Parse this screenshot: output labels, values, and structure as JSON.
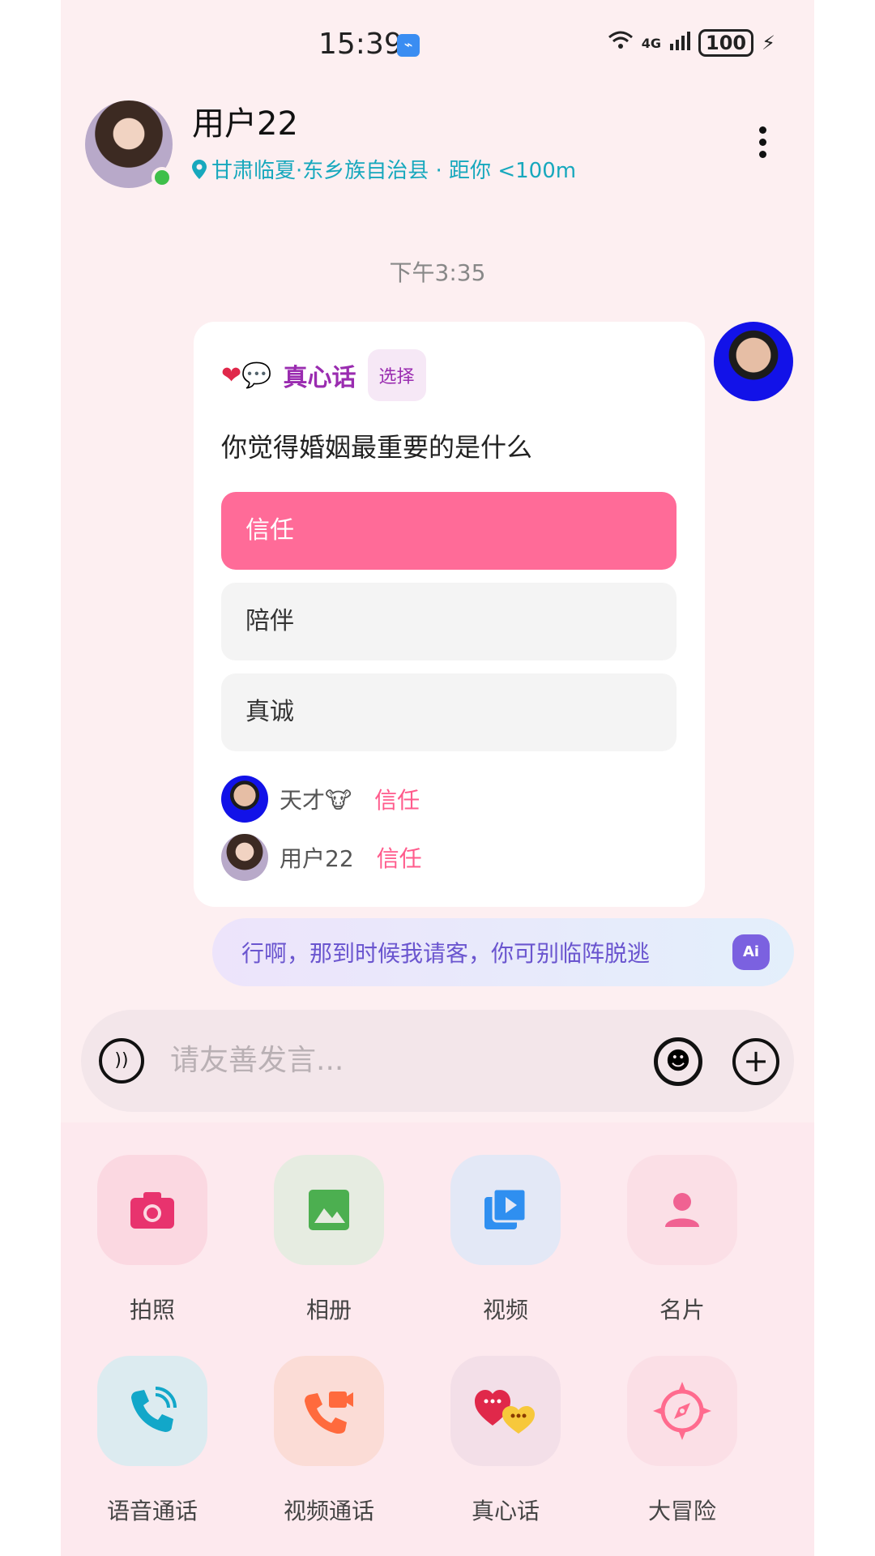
{
  "status": {
    "time": "15:39",
    "network": "4G",
    "battery": "100"
  },
  "header": {
    "username": "用户22",
    "location": "甘肃临夏·东乡族自治县 · 距你 <100m"
  },
  "chat": {
    "timestamp": "下午3:35",
    "card": {
      "title": "真心话",
      "tag": "选择",
      "question": "你觉得婚姻最重要的是什么",
      "options": [
        "信任",
        "陪伴",
        "真诚"
      ],
      "selected_option": "信任",
      "votes": [
        {
          "name": "天才🐮",
          "answer": "信任"
        },
        {
          "name": "用户22",
          "answer": "信任"
        }
      ]
    },
    "ai_suggestion": "行啊，那到时候我请客，你可别临阵脱逃",
    "ai_icon_label": "Ai"
  },
  "input": {
    "placeholder": "请友善发言..."
  },
  "actions": [
    {
      "label": "拍照",
      "icon": "camera-icon",
      "color": "#e8336e"
    },
    {
      "label": "相册",
      "icon": "image-icon",
      "color": "#4caf50"
    },
    {
      "label": "视频",
      "icon": "video-icon",
      "color": "#2f8ff0"
    },
    {
      "label": "名片",
      "icon": "contact-card-icon",
      "color": "#f06292"
    },
    {
      "label": "语音通话",
      "icon": "phone-icon",
      "color": "#12a7c9"
    },
    {
      "label": "视频通话",
      "icon": "video-call-icon",
      "color": "#ff6a3d"
    },
    {
      "label": "真心话",
      "icon": "hearts-chat-icon",
      "color": "#e0284a"
    },
    {
      "label": "大冒险",
      "icon": "compass-icon",
      "color": "#ff6b8e"
    }
  ]
}
